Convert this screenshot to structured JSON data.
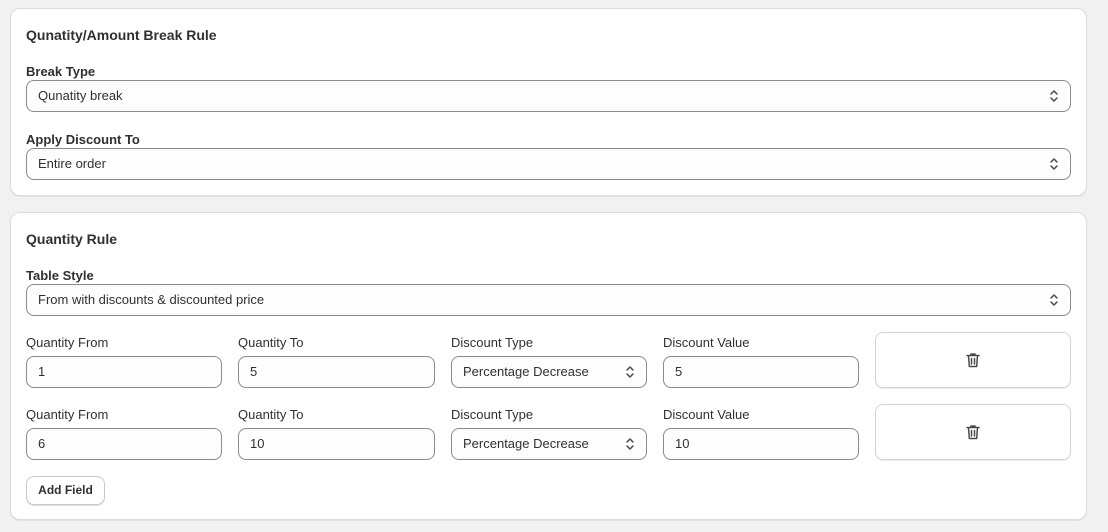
{
  "break_rule_card": {
    "title": "Qunatity/Amount Break Rule",
    "break_type": {
      "label": "Break Type",
      "value": "Qunatity break"
    },
    "apply_discount": {
      "label": "Apply Discount To",
      "value": "Entire order"
    }
  },
  "quantity_rule_card": {
    "title": "Quantity Rule",
    "table_style": {
      "label": "Table Style",
      "value": "From with discounts & discounted price"
    },
    "column_labels": {
      "quantity_from": "Quantity From",
      "quantity_to": "Quantity To",
      "discount_type": "Discount Type",
      "discount_value": "Discount Value"
    },
    "rows": [
      {
        "quantity_from": "1",
        "quantity_to": "5",
        "discount_type": "Percentage Decrease",
        "discount_value": "5"
      },
      {
        "quantity_from": "6",
        "quantity_to": "10",
        "discount_type": "Percentage Decrease",
        "discount_value": "10"
      }
    ],
    "add_field_label": "Add Field"
  },
  "icons": {
    "select_chevron": "chevron-up-down-icon",
    "delete": "trash-icon"
  },
  "colors": {
    "page_bg": "#f1f1f1",
    "card_bg": "#ffffff",
    "border": "#8a8a8a",
    "text": "#303030"
  }
}
